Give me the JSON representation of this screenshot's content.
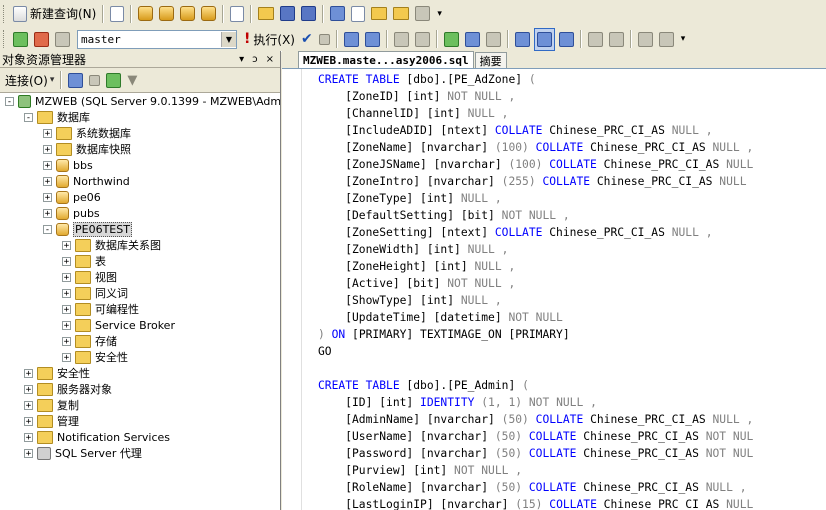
{
  "toolbar1": {
    "new_query_label": "新建查询(N)"
  },
  "toolbar2": {
    "database": "master",
    "execute_label": "执行(X)"
  },
  "object_explorer": {
    "title": "对象资源管理器",
    "pin": "ↄ",
    "close": "×",
    "connect_label": "连接(O)",
    "tree": [
      {
        "label": "MZWEB (SQL Server 9.0.1399 - MZWEB\\Admin",
        "level": 0,
        "icon": "server-icon",
        "expander": "-"
      },
      {
        "label": "数据库",
        "level": 1,
        "icon": "folder-icon",
        "expander": "-"
      },
      {
        "label": "系统数据库",
        "level": 2,
        "icon": "folder-icon",
        "expander": "+"
      },
      {
        "label": "数据库快照",
        "level": 2,
        "icon": "folder-icon",
        "expander": "+"
      },
      {
        "label": "bbs",
        "level": 2,
        "icon": "database-icon",
        "expander": "+"
      },
      {
        "label": "Northwind",
        "level": 2,
        "icon": "database-icon",
        "expander": "+"
      },
      {
        "label": "pe06",
        "level": 2,
        "icon": "database-icon",
        "expander": "+"
      },
      {
        "label": "pubs",
        "level": 2,
        "icon": "database-icon",
        "expander": "+"
      },
      {
        "label": "PE06TEST",
        "level": 2,
        "icon": "database-icon",
        "expander": "-",
        "selected": true
      },
      {
        "label": "数据库关系图",
        "level": 3,
        "icon": "folder-icon",
        "expander": "+"
      },
      {
        "label": "表",
        "level": 3,
        "icon": "folder-icon",
        "expander": "+"
      },
      {
        "label": "视图",
        "level": 3,
        "icon": "folder-icon",
        "expander": "+"
      },
      {
        "label": "同义词",
        "level": 3,
        "icon": "folder-icon",
        "expander": "+"
      },
      {
        "label": "可编程性",
        "level": 3,
        "icon": "folder-icon",
        "expander": "+"
      },
      {
        "label": "Service Broker",
        "level": 3,
        "icon": "folder-icon",
        "expander": "+"
      },
      {
        "label": "存储",
        "level": 3,
        "icon": "folder-icon",
        "expander": "+"
      },
      {
        "label": "安全性",
        "level": 3,
        "icon": "folder-icon",
        "expander": "+"
      },
      {
        "label": "安全性",
        "level": 1,
        "icon": "folder-icon",
        "expander": "+"
      },
      {
        "label": "服务器对象",
        "level": 1,
        "icon": "folder-icon",
        "expander": "+"
      },
      {
        "label": "复制",
        "level": 1,
        "icon": "folder-icon",
        "expander": "+"
      },
      {
        "label": "管理",
        "level": 1,
        "icon": "folder-icon",
        "expander": "+"
      },
      {
        "label": "Notification Services",
        "level": 1,
        "icon": "folder-icon",
        "expander": "+"
      },
      {
        "label": "SQL Server 代理",
        "level": 1,
        "icon": "agent-icon",
        "expander": "+"
      }
    ]
  },
  "editor": {
    "tabs": [
      {
        "label": "MZWEB.maste...asy2006.sql",
        "active": true
      },
      {
        "label": "摘要",
        "active": false
      }
    ],
    "lines": [
      [
        [
          "CREATE TABLE",
          "kw"
        ],
        [
          " [dbo].[PE_AdZone] ",
          ""
        ],
        [
          "(",
          "gr"
        ]
      ],
      [
        [
          "    [ZoneID] [int] ",
          ""
        ],
        [
          "NOT NULL ,",
          "gr"
        ]
      ],
      [
        [
          "    [ChannelID] [int] ",
          ""
        ],
        [
          "NULL ,",
          "gr"
        ]
      ],
      [
        [
          "    [IncludeADID] [ntext] ",
          ""
        ],
        [
          "COLLATE",
          "kw"
        ],
        [
          " Chinese_PRC_CI_AS ",
          ""
        ],
        [
          "NULL ,",
          "gr"
        ]
      ],
      [
        [
          "    [ZoneName] [nvarchar] ",
          ""
        ],
        [
          "(100) ",
          "gr"
        ],
        [
          "COLLATE",
          "kw"
        ],
        [
          " Chinese_PRC_CI_AS ",
          ""
        ],
        [
          "NULL ,",
          "gr"
        ]
      ],
      [
        [
          "    [ZoneJSName] [nvarchar] ",
          ""
        ],
        [
          "(100) ",
          "gr"
        ],
        [
          "COLLATE",
          "kw"
        ],
        [
          " Chinese_PRC_CI_AS ",
          ""
        ],
        [
          "NULL",
          "gr"
        ]
      ],
      [
        [
          "    [ZoneIntro] [nvarchar] ",
          ""
        ],
        [
          "(255) ",
          "gr"
        ],
        [
          "COLLATE",
          "kw"
        ],
        [
          " Chinese_PRC_CI_AS ",
          ""
        ],
        [
          "NULL",
          "gr"
        ]
      ],
      [
        [
          "    [ZoneType] [int] ",
          ""
        ],
        [
          "NULL ,",
          "gr"
        ]
      ],
      [
        [
          "    [DefaultSetting] [bit] ",
          ""
        ],
        [
          "NOT NULL ,",
          "gr"
        ]
      ],
      [
        [
          "    [ZoneSetting] [ntext] ",
          ""
        ],
        [
          "COLLATE",
          "kw"
        ],
        [
          " Chinese_PRC_CI_AS ",
          ""
        ],
        [
          "NULL ,",
          "gr"
        ]
      ],
      [
        [
          "    [ZoneWidth] [int] ",
          ""
        ],
        [
          "NULL ,",
          "gr"
        ]
      ],
      [
        [
          "    [ZoneHeight] [int] ",
          ""
        ],
        [
          "NULL ,",
          "gr"
        ]
      ],
      [
        [
          "    [Active] [bit] ",
          ""
        ],
        [
          "NOT NULL ,",
          "gr"
        ]
      ],
      [
        [
          "    [ShowType] [int] ",
          ""
        ],
        [
          "NULL ,",
          "gr"
        ]
      ],
      [
        [
          "    [UpdateTime] [datetime] ",
          ""
        ],
        [
          "NOT NULL",
          "gr"
        ]
      ],
      [
        [
          ") ",
          "gr"
        ],
        [
          "ON",
          "kw"
        ],
        [
          " [PRIMARY] TEXTIMAGE_ON [PRIMARY]",
          ""
        ]
      ],
      [
        [
          "GO",
          ""
        ]
      ],
      [
        [
          "",
          ""
        ]
      ],
      [
        [
          "CREATE TABLE",
          "kw"
        ],
        [
          " [dbo].[PE_Admin] ",
          ""
        ],
        [
          "(",
          "gr"
        ]
      ],
      [
        [
          "    [ID] [int] ",
          ""
        ],
        [
          "IDENTITY",
          "kw"
        ],
        [
          " (1, 1) ",
          "gr"
        ],
        [
          "NOT NULL ,",
          "gr"
        ]
      ],
      [
        [
          "    [AdminName] [nvarchar] ",
          ""
        ],
        [
          "(50) ",
          "gr"
        ],
        [
          "COLLATE",
          "kw"
        ],
        [
          " Chinese_PRC_CI_AS ",
          ""
        ],
        [
          "NULL ,",
          "gr"
        ]
      ],
      [
        [
          "    [UserName] [nvarchar] ",
          ""
        ],
        [
          "(50) ",
          "gr"
        ],
        [
          "COLLATE",
          "kw"
        ],
        [
          " Chinese_PRC_CI_AS ",
          ""
        ],
        [
          "NOT NUL",
          "gr"
        ]
      ],
      [
        [
          "    [Password] [nvarchar] ",
          ""
        ],
        [
          "(50) ",
          "gr"
        ],
        [
          "COLLATE",
          "kw"
        ],
        [
          " Chinese_PRC_CI_AS ",
          ""
        ],
        [
          "NOT NUL",
          "gr"
        ]
      ],
      [
        [
          "    [Purview] [int] ",
          ""
        ],
        [
          "NOT NULL ,",
          "gr"
        ]
      ],
      [
        [
          "    [RoleName] [nvarchar] ",
          ""
        ],
        [
          "(50) ",
          "gr"
        ],
        [
          "COLLATE",
          "kw"
        ],
        [
          " Chinese_PRC_CI_AS ",
          ""
        ],
        [
          "NULL ,",
          "gr"
        ]
      ],
      [
        [
          "    [LastLoginIP] [nvarchar] ",
          ""
        ],
        [
          "(15) ",
          "gr"
        ],
        [
          "COLLATE",
          "kw"
        ],
        [
          " Chinese_PRC_CI_AS ",
          ""
        ],
        [
          "NULL",
          "gr"
        ]
      ]
    ]
  }
}
